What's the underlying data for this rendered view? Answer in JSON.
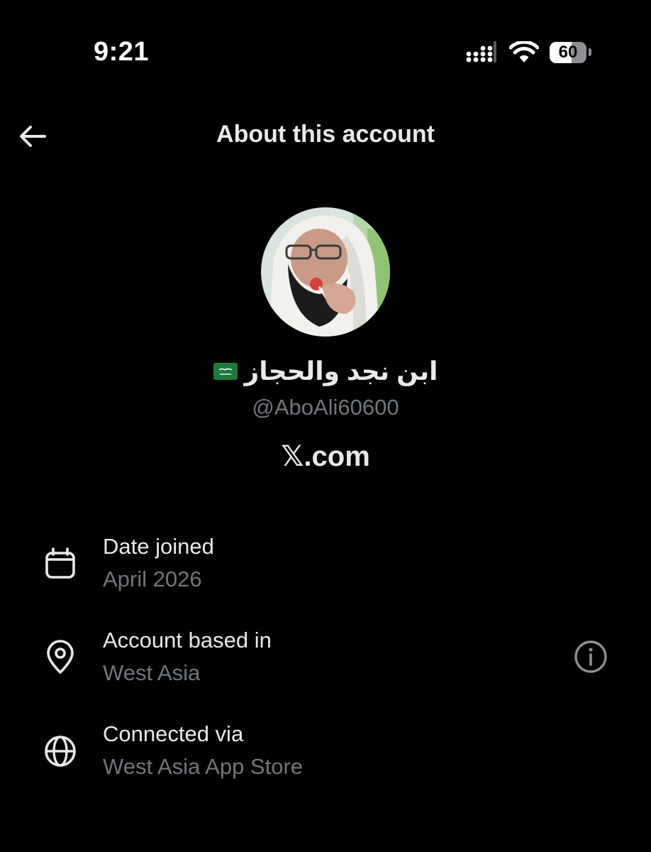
{
  "status_bar": {
    "time": "9:21",
    "battery": "60",
    "icons": [
      "cellular-signal-icon",
      "wifi-icon",
      "battery-icon"
    ]
  },
  "header": {
    "title": "About this account",
    "back_icon": "arrow-left-icon"
  },
  "profile": {
    "display_name": "ابن نجد والحجاز",
    "flag": "saudi-arabia-flag-icon",
    "handle": "@AboAli60600",
    "site": "𝕏.com"
  },
  "details": [
    {
      "icon": "calendar-icon",
      "label": "Date joined",
      "value": "April 2026"
    },
    {
      "icon": "location-pin-icon",
      "label": "Account based in",
      "value": "West Asia",
      "help_icon": "info-circle-icon"
    },
    {
      "icon": "globe-icon",
      "label": "Connected via",
      "value": "West Asia App Store"
    }
  ],
  "colors": {
    "background": "#000000",
    "primary_text": "#e7e9ea",
    "secondary_text": "#71767b",
    "flag_green": "#1b7a3a"
  }
}
